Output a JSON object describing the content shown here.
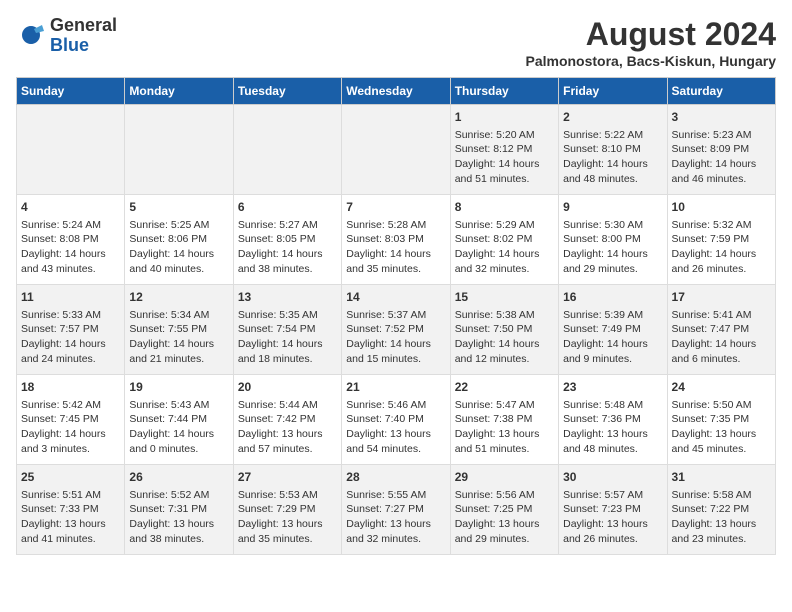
{
  "logo": {
    "general": "General",
    "blue": "Blue"
  },
  "title": "August 2024",
  "subtitle": "Palmonostora, Bacs-Kiskun, Hungary",
  "days_of_week": [
    "Sunday",
    "Monday",
    "Tuesday",
    "Wednesday",
    "Thursday",
    "Friday",
    "Saturday"
  ],
  "weeks": [
    [
      {
        "day": "",
        "content": ""
      },
      {
        "day": "",
        "content": ""
      },
      {
        "day": "",
        "content": ""
      },
      {
        "day": "",
        "content": ""
      },
      {
        "day": "1",
        "content": "Sunrise: 5:20 AM\nSunset: 8:12 PM\nDaylight: 14 hours\nand 51 minutes."
      },
      {
        "day": "2",
        "content": "Sunrise: 5:22 AM\nSunset: 8:10 PM\nDaylight: 14 hours\nand 48 minutes."
      },
      {
        "day": "3",
        "content": "Sunrise: 5:23 AM\nSunset: 8:09 PM\nDaylight: 14 hours\nand 46 minutes."
      }
    ],
    [
      {
        "day": "4",
        "content": "Sunrise: 5:24 AM\nSunset: 8:08 PM\nDaylight: 14 hours\nand 43 minutes."
      },
      {
        "day": "5",
        "content": "Sunrise: 5:25 AM\nSunset: 8:06 PM\nDaylight: 14 hours\nand 40 minutes."
      },
      {
        "day": "6",
        "content": "Sunrise: 5:27 AM\nSunset: 8:05 PM\nDaylight: 14 hours\nand 38 minutes."
      },
      {
        "day": "7",
        "content": "Sunrise: 5:28 AM\nSunset: 8:03 PM\nDaylight: 14 hours\nand 35 minutes."
      },
      {
        "day": "8",
        "content": "Sunrise: 5:29 AM\nSunset: 8:02 PM\nDaylight: 14 hours\nand 32 minutes."
      },
      {
        "day": "9",
        "content": "Sunrise: 5:30 AM\nSunset: 8:00 PM\nDaylight: 14 hours\nand 29 minutes."
      },
      {
        "day": "10",
        "content": "Sunrise: 5:32 AM\nSunset: 7:59 PM\nDaylight: 14 hours\nand 26 minutes."
      }
    ],
    [
      {
        "day": "11",
        "content": "Sunrise: 5:33 AM\nSunset: 7:57 PM\nDaylight: 14 hours\nand 24 minutes."
      },
      {
        "day": "12",
        "content": "Sunrise: 5:34 AM\nSunset: 7:55 PM\nDaylight: 14 hours\nand 21 minutes."
      },
      {
        "day": "13",
        "content": "Sunrise: 5:35 AM\nSunset: 7:54 PM\nDaylight: 14 hours\nand 18 minutes."
      },
      {
        "day": "14",
        "content": "Sunrise: 5:37 AM\nSunset: 7:52 PM\nDaylight: 14 hours\nand 15 minutes."
      },
      {
        "day": "15",
        "content": "Sunrise: 5:38 AM\nSunset: 7:50 PM\nDaylight: 14 hours\nand 12 minutes."
      },
      {
        "day": "16",
        "content": "Sunrise: 5:39 AM\nSunset: 7:49 PM\nDaylight: 14 hours\nand 9 minutes."
      },
      {
        "day": "17",
        "content": "Sunrise: 5:41 AM\nSunset: 7:47 PM\nDaylight: 14 hours\nand 6 minutes."
      }
    ],
    [
      {
        "day": "18",
        "content": "Sunrise: 5:42 AM\nSunset: 7:45 PM\nDaylight: 14 hours\nand 3 minutes."
      },
      {
        "day": "19",
        "content": "Sunrise: 5:43 AM\nSunset: 7:44 PM\nDaylight: 14 hours\nand 0 minutes."
      },
      {
        "day": "20",
        "content": "Sunrise: 5:44 AM\nSunset: 7:42 PM\nDaylight: 13 hours\nand 57 minutes."
      },
      {
        "day": "21",
        "content": "Sunrise: 5:46 AM\nSunset: 7:40 PM\nDaylight: 13 hours\nand 54 minutes."
      },
      {
        "day": "22",
        "content": "Sunrise: 5:47 AM\nSunset: 7:38 PM\nDaylight: 13 hours\nand 51 minutes."
      },
      {
        "day": "23",
        "content": "Sunrise: 5:48 AM\nSunset: 7:36 PM\nDaylight: 13 hours\nand 48 minutes."
      },
      {
        "day": "24",
        "content": "Sunrise: 5:50 AM\nSunset: 7:35 PM\nDaylight: 13 hours\nand 45 minutes."
      }
    ],
    [
      {
        "day": "25",
        "content": "Sunrise: 5:51 AM\nSunset: 7:33 PM\nDaylight: 13 hours\nand 41 minutes."
      },
      {
        "day": "26",
        "content": "Sunrise: 5:52 AM\nSunset: 7:31 PM\nDaylight: 13 hours\nand 38 minutes."
      },
      {
        "day": "27",
        "content": "Sunrise: 5:53 AM\nSunset: 7:29 PM\nDaylight: 13 hours\nand 35 minutes."
      },
      {
        "day": "28",
        "content": "Sunrise: 5:55 AM\nSunset: 7:27 PM\nDaylight: 13 hours\nand 32 minutes."
      },
      {
        "day": "29",
        "content": "Sunrise: 5:56 AM\nSunset: 7:25 PM\nDaylight: 13 hours\nand 29 minutes."
      },
      {
        "day": "30",
        "content": "Sunrise: 5:57 AM\nSunset: 7:23 PM\nDaylight: 13 hours\nand 26 minutes."
      },
      {
        "day": "31",
        "content": "Sunrise: 5:58 AM\nSunset: 7:22 PM\nDaylight: 13 hours\nand 23 minutes."
      }
    ]
  ]
}
